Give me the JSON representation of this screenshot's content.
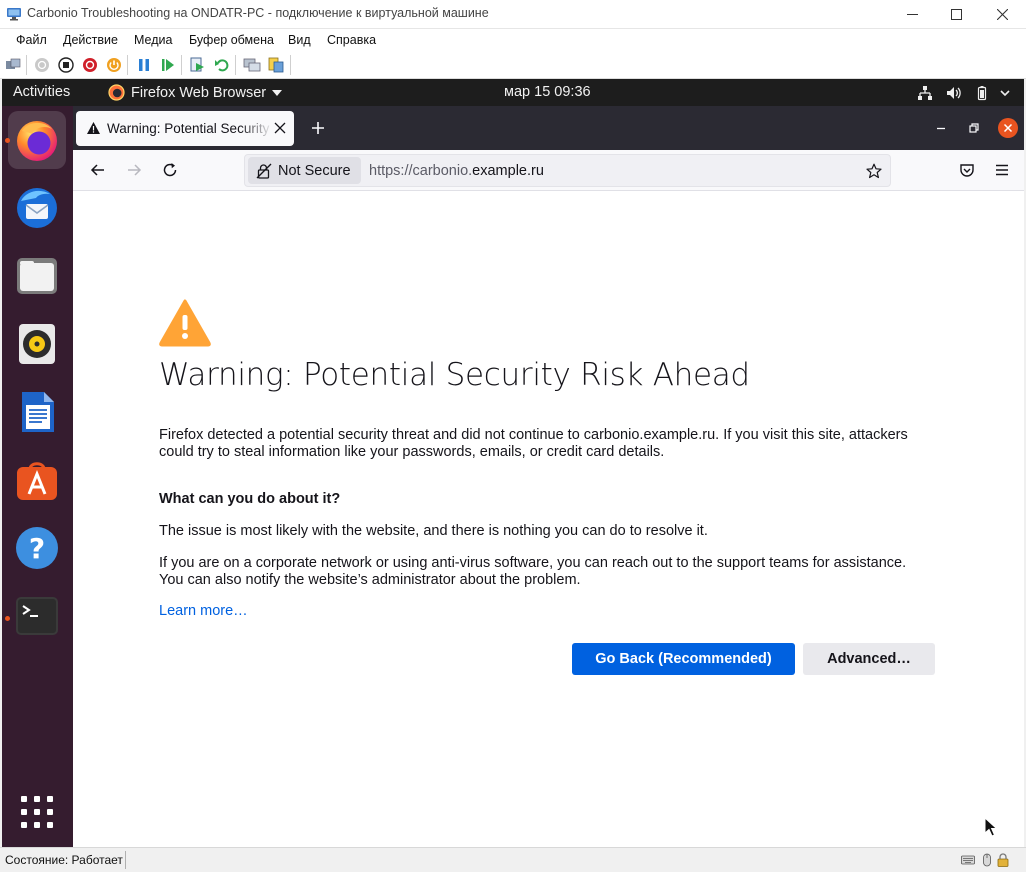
{
  "host_window": {
    "title": "Carbonio Troubleshooting на ONDATR-PC - подключение к виртуальной машине",
    "menu": [
      "Файл",
      "Действие",
      "Медиа",
      "Буфер обмена",
      "Вид",
      "Справка"
    ],
    "status_text": "Состояние: Работает"
  },
  "gnome": {
    "activities": "Activities",
    "app_menu": "Firefox Web Browser",
    "clock": "мар 15  09:36"
  },
  "dock": {
    "apps": [
      "firefox-icon",
      "thunderbird-icon",
      "files-icon",
      "rhythmbox-icon",
      "libreoffice-writer-icon",
      "app-center-icon",
      "help-icon",
      "terminal-icon"
    ],
    "show_apps": "grid-icon"
  },
  "firefox": {
    "tab_title": "Warning: Potential Security Risk Ahead",
    "not_secure": "Not Secure",
    "url_scheme": "https://carbonio.",
    "url_host": "example.ru"
  },
  "page": {
    "heading": "Warning: Potential Security Risk Ahead",
    "intro": "Firefox detected a potential security threat and did not continue to carbonio.example.ru. If you visit this site, attackers could try to steal information like your passwords, emails, or credit card details.",
    "what_heading": "What can you do about it?",
    "para1": "The issue is most likely with the website, and there is nothing you can do to resolve it.",
    "para2": "If you are on a corporate network or using anti-virus software, you can reach out to the support teams for assistance. You can also notify the website’s administrator about the problem.",
    "learn_more": "Learn more…",
    "go_back": "Go Back (Recommended)",
    "advanced": "Advanced…"
  },
  "colors": {
    "accent_blue": "#0061e0",
    "warning_orange": "#ffa436",
    "ubuntu_orange": "#e95420",
    "dock_bg": "#351c2f"
  }
}
